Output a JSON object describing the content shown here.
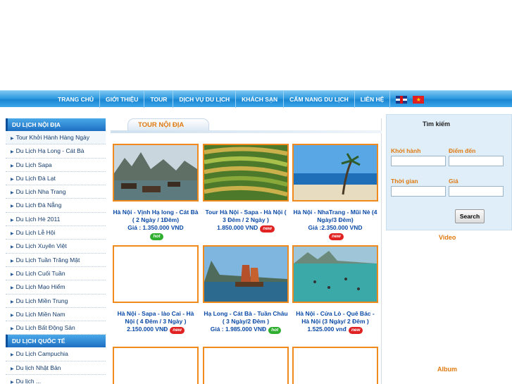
{
  "nav": {
    "items": [
      "TRANG CHỦ",
      "GIỚI THIỆU",
      "TOUR",
      "DỊCH VỤ DU LỊCH",
      "KHÁCH SẠN",
      "CẨM NANG DU LỊCH",
      "LIÊN HỆ"
    ],
    "flag_vn_glyph": "★"
  },
  "sidebar": {
    "domestic_title": "DU LỊCH NỘI ĐỊA",
    "domestic_items": [
      "Tour Khởi Hành Hàng Ngày",
      "Du Lịch Hạ Long - Cát Bà",
      "Du Lịch Sapa",
      "Du Lịch Đà Lạt",
      "Du Lịch Nha Trang",
      "Du Lịch Đà Nẵng",
      "Du Lịch Hè 2011",
      "Du Lịch Lễ Hội",
      "Du Lịch Xuyên Việt",
      "Du Lịch Tuần Trăng Mật",
      "Du Lịch Cuối Tuần",
      "Du Lịch Mạo Hiểm",
      "Du Lịch Miền Trung",
      "Du Lịch Miền Nam",
      "Du Lịch Bất Động Sản"
    ],
    "intl_title": "DU LỊCH QUỐC TẾ",
    "intl_items": [
      "Du Lịch Campuchia",
      "Du lịch Nhật Bản",
      "Du lịch ..."
    ]
  },
  "main": {
    "tab_title": "TOUR NỘI ĐỊA",
    "tours": [
      {
        "caption": "Hà Nội - Vịnh Hạ long - Cát Bà ( 2 Ngày / 1Đêm)",
        "price": "Giá : 1.350.000 VND",
        "badge": "hot",
        "image": "halong-boats"
      },
      {
        "caption": "Tour Hà Nội - Sapa - Hà Nội ( 3 Đêm / 2 Ngày )",
        "price": "1.850.000 VND",
        "badge": "new",
        "image": "rice-terraces"
      },
      {
        "caption": "Hà Nội - NhaTrang - Mũi Nè (4 Ngày/3 Đêm)",
        "price": "Giá :2.350.000 VND",
        "badge": "new",
        "image": "beach-palm"
      },
      {
        "caption": "Hà Nội - Sapa - lào Cai - Hà Nội ( 4 Đêm / 3 Ngày )",
        "price": "2.150.000 VNĐ",
        "badge": "new",
        "image": "blank"
      },
      {
        "caption": "Hạ Long - Cát Bà - Tuần Châu ( 3 Ngày/2 Đêm )",
        "price": "Giá : 1.985.000 VNĐ",
        "badge": "hot",
        "image": "junk-boat"
      },
      {
        "caption": "Hà Nội - Cửa Lò - Quê Bác - Hà Nội (3 Ngày/ 2 Đêm )",
        "price": "1.525.000 vnđ",
        "badge": "new",
        "image": "beach-people"
      }
    ],
    "badges": {
      "hot": "hot",
      "new": "new"
    }
  },
  "search": {
    "title": "Tìm kiếm",
    "depart_label": "Khởi hành",
    "dest_label": "Điểm đến",
    "time_label": "Thời gian",
    "price_label": "Giá",
    "button_label": "Search",
    "depart_value": "",
    "dest_value": "",
    "time_value": "",
    "price_value": ""
  },
  "right": {
    "video_title": "Video",
    "album_title": "Album"
  },
  "colors": {
    "nav_blue": "#1a86d3",
    "accent_orange": "#e07a10",
    "link_blue": "#0b4aa6",
    "tile_border": "#f08a1c"
  }
}
